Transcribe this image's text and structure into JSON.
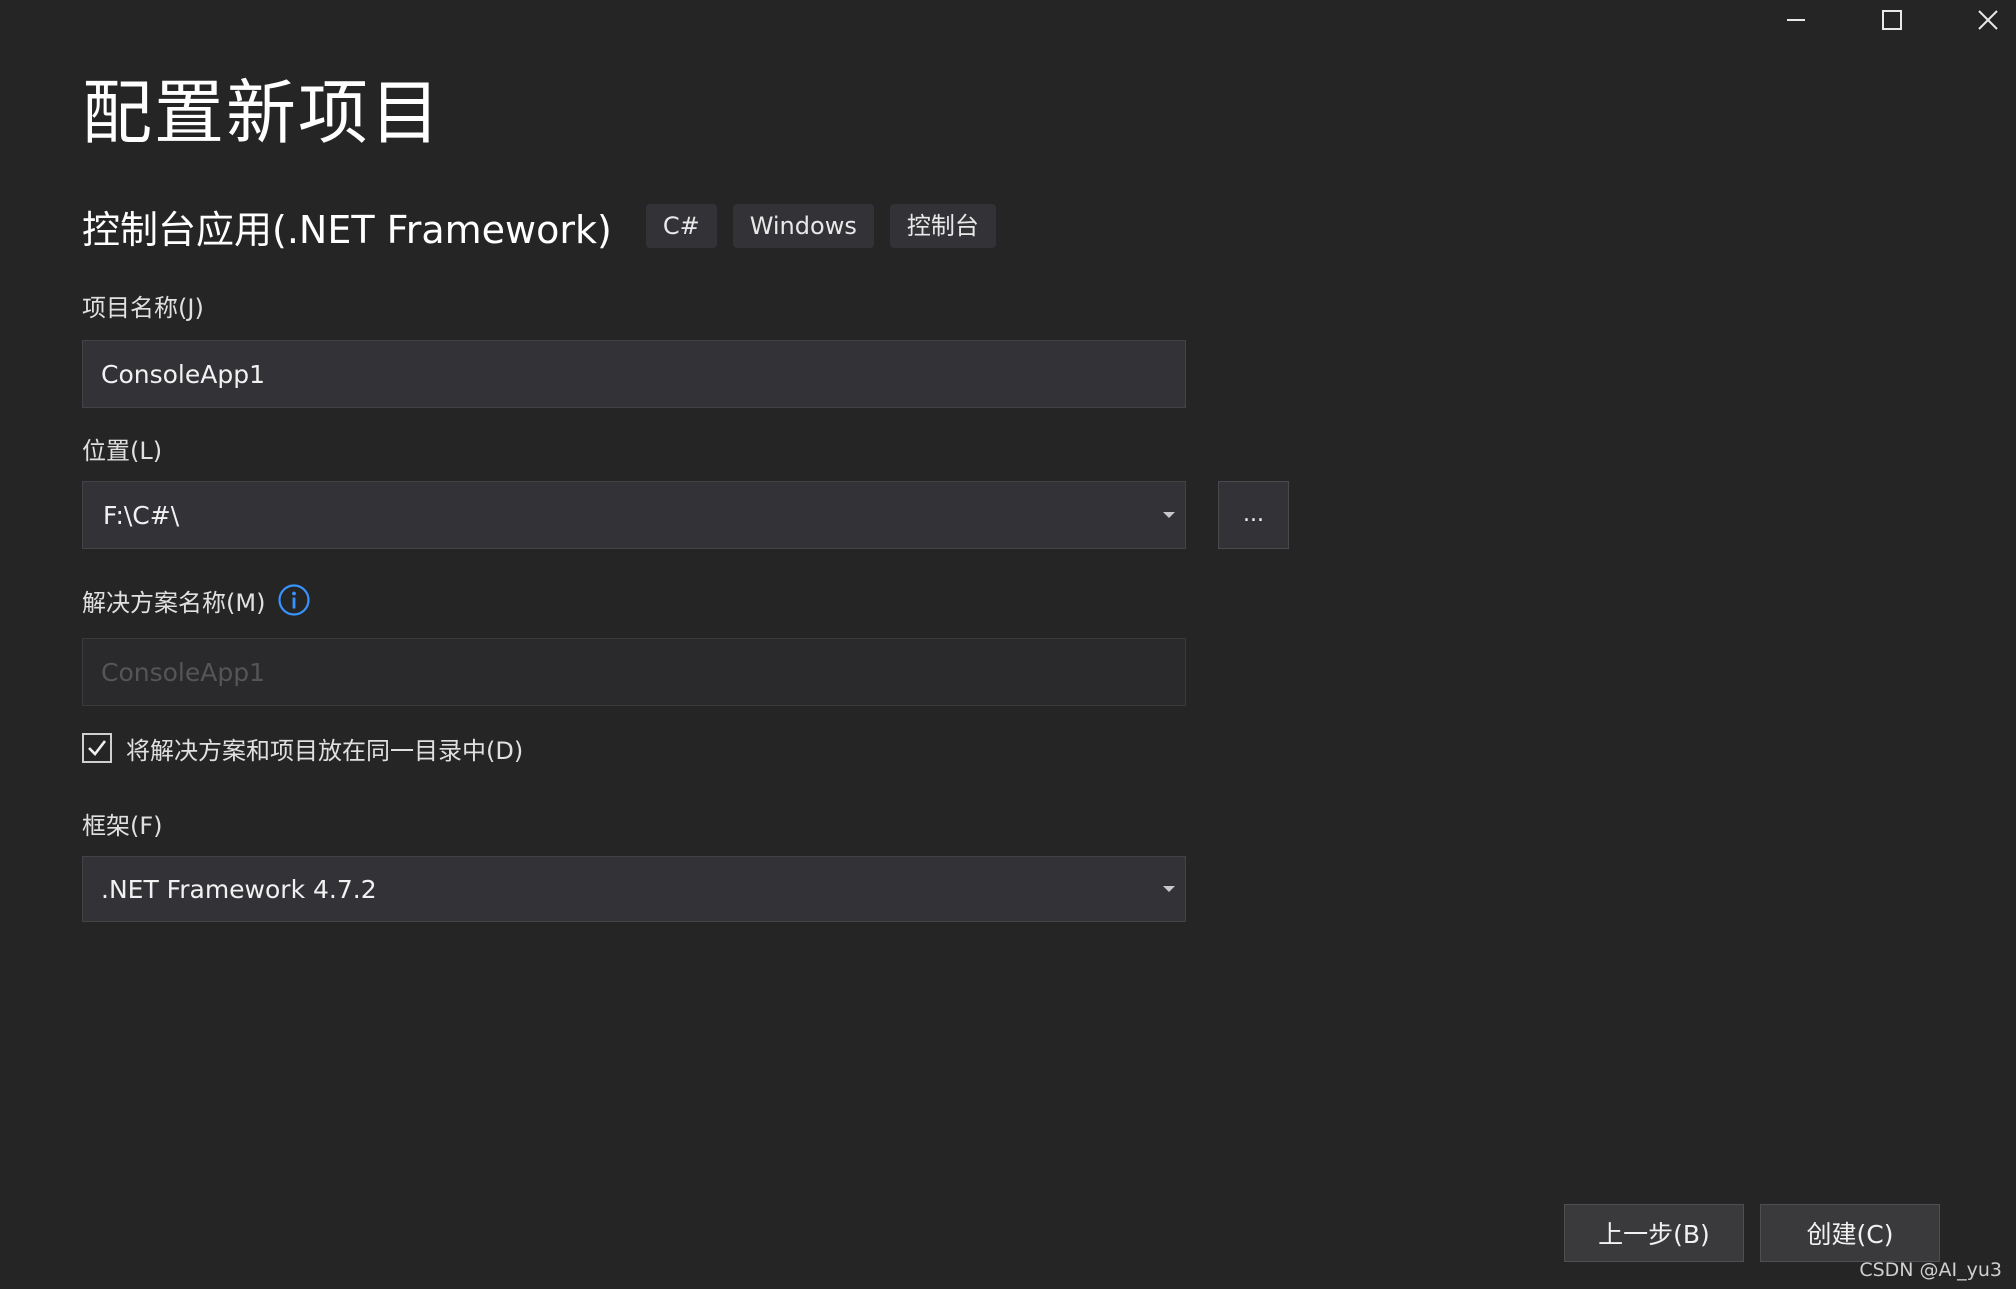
{
  "page": {
    "title": "配置新项目",
    "template_name": "控制台应用(.NET Framework)",
    "tags": [
      "C#",
      "Windows",
      "控制台"
    ]
  },
  "form": {
    "project_name": {
      "label": "项目名称(J)",
      "value": "ConsoleApp1"
    },
    "location": {
      "label": "位置(L)",
      "value": "F:\\C#\\",
      "browse_label": "..."
    },
    "solution_name": {
      "label": "解决方案名称(M)",
      "value": "ConsoleApp1",
      "disabled": true
    },
    "same_directory": {
      "label": "将解决方案和项目放在同一目录中(D)",
      "checked": true
    },
    "framework": {
      "label": "框架(F)",
      "value": ".NET Framework 4.7.2"
    }
  },
  "footer": {
    "back_label": "上一步(B)",
    "create_label": "创建(C)"
  },
  "watermark": "CSDN @AI_yu3",
  "colors": {
    "background": "#252526",
    "input_background": "#333337",
    "info_icon": "#3794ff"
  },
  "icons": {
    "minimize": "minimize-icon",
    "maximize": "maximize-icon",
    "close": "close-icon",
    "info": "info-icon",
    "checkmark": "checkmark-icon",
    "dropdown": "chevron-down-icon"
  }
}
